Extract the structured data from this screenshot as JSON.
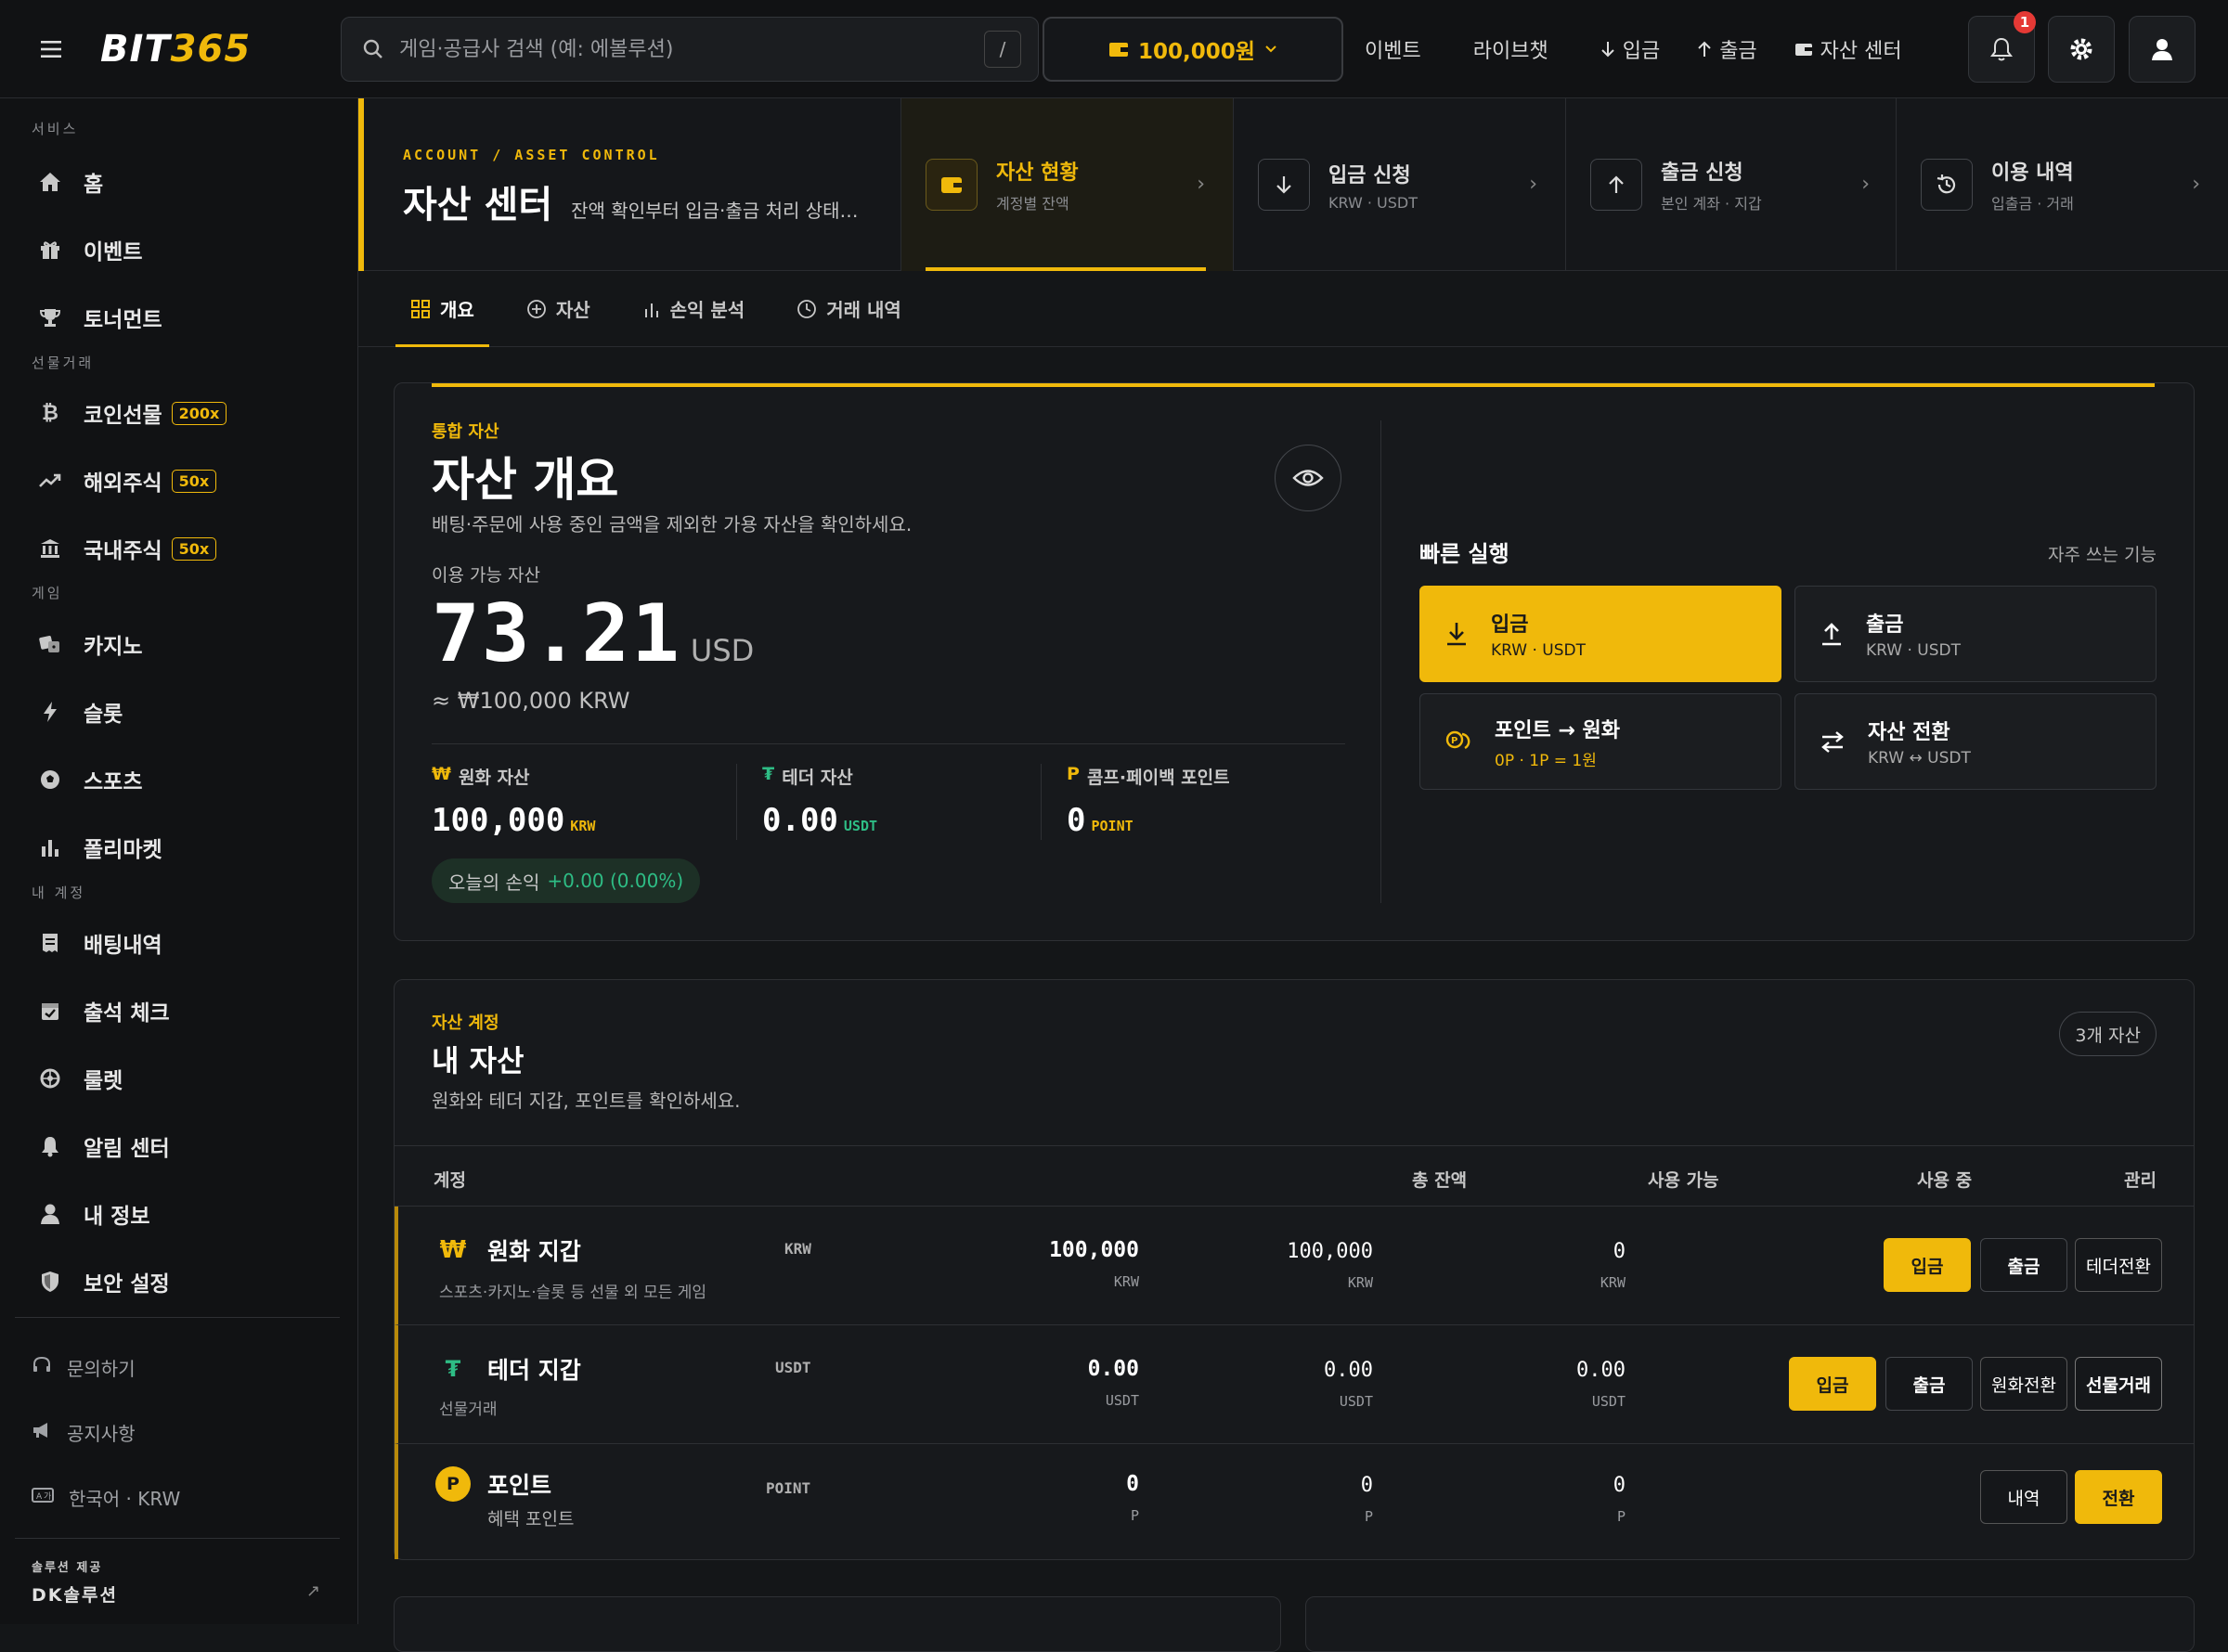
{
  "topbar": {
    "logo_prefix": "BIT",
    "logo_number": "365",
    "search_placeholder": "게임·공급사 검색 (예: 에볼루션)",
    "search_shortcut": "/",
    "wallet_balance": "100,000원",
    "nav": [
      {
        "label": "이벤트",
        "icon": ""
      },
      {
        "label": "라이브챗",
        "icon": ""
      },
      {
        "label": "입금",
        "icon": "arrow-down-icon"
      },
      {
        "label": "출금",
        "icon": "arrow-up-icon"
      },
      {
        "label": "자산 센터",
        "icon": "wallet-icon"
      }
    ],
    "notification_count": "1"
  },
  "sidebar": {
    "sections": {
      "service": "서비스",
      "futures": "선물거래",
      "game": "게임",
      "account": "내 계정"
    },
    "items": [
      {
        "label": "홈",
        "icon": "home-icon"
      },
      {
        "label": "이벤트",
        "icon": "gift-icon"
      },
      {
        "label": "토너먼트",
        "icon": "trophy-icon"
      },
      {
        "label": "코인선물",
        "icon": "bitcoin-icon",
        "badge": "200x"
      },
      {
        "label": "해외주식",
        "icon": "trend-up-icon",
        "badge": "50x"
      },
      {
        "label": "국내주식",
        "icon": "bank-icon",
        "badge": "50x"
      },
      {
        "label": "카지노",
        "icon": "dice-icon"
      },
      {
        "label": "슬롯",
        "icon": "bolt-icon"
      },
      {
        "label": "스포츠",
        "icon": "soccer-ball-icon"
      },
      {
        "label": "폴리마켓",
        "icon": "bar-chart-icon"
      },
      {
        "label": "배팅내역",
        "icon": "receipt-icon"
      },
      {
        "label": "출석 체크",
        "icon": "calendar-check-icon"
      },
      {
        "label": "룰렛",
        "icon": "roulette-icon"
      },
      {
        "label": "알림 센터",
        "icon": "bell-icon"
      },
      {
        "label": "내 정보",
        "icon": "user-icon"
      },
      {
        "label": "보안 설정",
        "icon": "shield-icon"
      }
    ],
    "footer": [
      {
        "label": "문의하기",
        "icon": "headset-icon"
      },
      {
        "label": "공지사항",
        "icon": "megaphone-icon"
      },
      {
        "label": "한국어 · KRW",
        "icon": "language-icon"
      }
    ],
    "solution_label": "솔루션 제공",
    "solution_name": "DK솔루션"
  },
  "header": {
    "kicker": "ACCOUNT / ASSET CONTROL",
    "title": "자산 센터",
    "subtitle": "잔액 확인부터 입금·출금 처리 상태까…",
    "cards": [
      {
        "title": "자산 현황",
        "sub": "계정별 잔액",
        "icon": "wallet-icon",
        "active": true
      },
      {
        "title": "입금 신청",
        "sub": "KRW · USDT",
        "icon": "arrow-down-icon"
      },
      {
        "title": "출금 신청",
        "sub": "본인 계좌 · 지갑",
        "icon": "arrow-up-icon"
      },
      {
        "title": "이용 내역",
        "sub": "입출금 · 거래",
        "icon": "history-icon"
      }
    ]
  },
  "tabs": [
    {
      "label": "개요",
      "icon": "grid-icon",
      "active": true
    },
    {
      "label": "자산",
      "icon": "plus-circle-icon"
    },
    {
      "label": "손익 분석",
      "icon": "bar-chart-icon"
    },
    {
      "label": "거래 내역",
      "icon": "clock-icon"
    }
  ],
  "overview": {
    "kicker": "통합 자산",
    "title": "자산 개요",
    "description": "배팅·주문에 사용 중인 금액을 제외한 가용 자산을 확인하세요.",
    "available_label": "이용 가능 자산",
    "available_amount": "73.21",
    "available_unit": "USD",
    "krw_equivalent": "≈ ₩100,000 KRW",
    "balances": [
      {
        "symbol": "₩",
        "label": "원화 자산",
        "value": "100,000",
        "unit": "KRW"
      },
      {
        "symbol": "₮",
        "label": "테더 자산",
        "value": "0.00",
        "unit": "USDT"
      },
      {
        "symbol": "P",
        "label": "콤프·페이백 포인트",
        "value": "0",
        "unit": "POINT"
      }
    ],
    "today_pnl_label": "오늘의 손익",
    "today_pnl_value": "+0.00 (0.00%)",
    "quick": {
      "title": "빠른 실행",
      "hint": "자주 쓰는 기능",
      "actions": [
        {
          "title": "입금",
          "sub": "KRW · USDT",
          "icon": "download-icon"
        },
        {
          "title": "출금",
          "sub": "KRW · USDT",
          "icon": "upload-icon"
        },
        {
          "title": "포인트 → 원화",
          "sub": "0P · 1P = 1원",
          "icon": "coins-icon"
        },
        {
          "title": "자산 전환",
          "sub": "KRW ↔ USDT",
          "icon": "swap-icon"
        }
      ]
    }
  },
  "assets": {
    "kicker": "자산 계정",
    "title": "내 자산",
    "description": "원화와 테더 지갑, 포인트를 확인하세요.",
    "count_pill": "3개 자산",
    "columns": [
      "계정",
      "총 잔액",
      "사용 가능",
      "사용 중",
      "관리"
    ],
    "rows": [
      {
        "symbol": "₩",
        "name": "원화 지갑",
        "desc": "스포츠·카지노·슬롯 등 선물 외 모든 게임",
        "currency": "KRW",
        "total": "100,000",
        "available": "100,000",
        "in_use": "0",
        "unit": "KRW",
        "actions": [
          "입금",
          "출금",
          "테더전환"
        ]
      },
      {
        "symbol": "₮",
        "name": "테더 지갑",
        "desc": "선물거래",
        "currency": "USDT",
        "total": "0.00",
        "available": "0.00",
        "in_use": "0.00",
        "unit": "USDT",
        "actions": [
          "입금",
          "출금",
          "원화전환",
          "선물거래"
        ]
      },
      {
        "symbol": "P",
        "name": "포인트",
        "desc": "혜택 포인트",
        "currency": "POINT",
        "total": "0",
        "available": "0",
        "in_use": "0",
        "unit": "P",
        "actions": [
          "내역",
          "전환"
        ]
      }
    ]
  },
  "colors": {
    "accent": "#f0b90b",
    "positive": "#2ebd85",
    "alert": "#e53935",
    "bg": "#141618"
  }
}
